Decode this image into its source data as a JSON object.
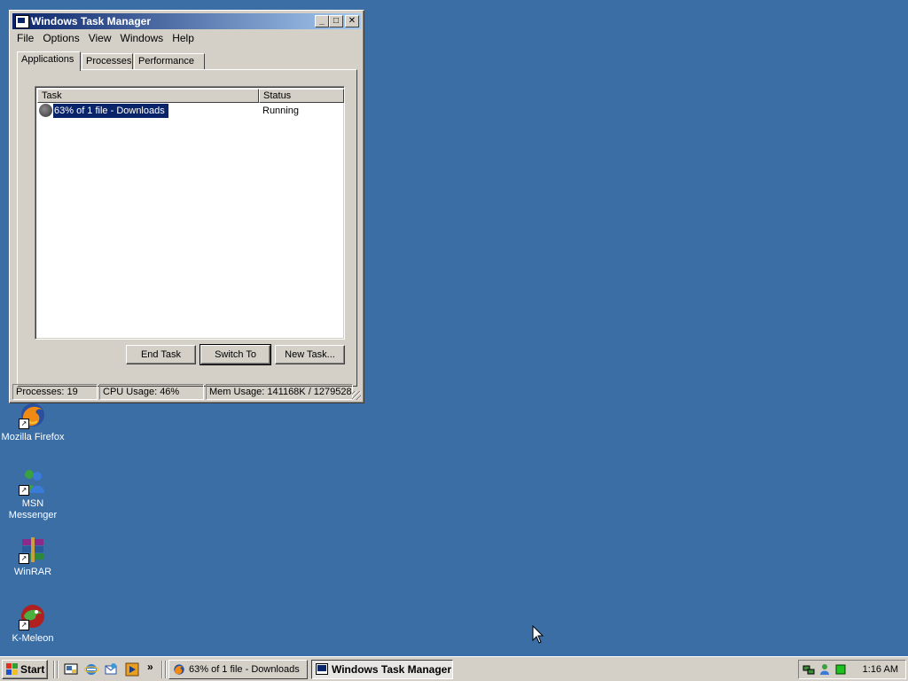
{
  "desktop": {
    "icons": [
      {
        "label": "Mozilla Firefox"
      },
      {
        "label": "MSN Messenger"
      },
      {
        "label": "WinRAR"
      },
      {
        "label": "K-Meleon"
      }
    ]
  },
  "window": {
    "title": "Windows Task Manager",
    "menu": [
      "File",
      "Options",
      "View",
      "Windows",
      "Help"
    ],
    "tabs": [
      "Applications",
      "Processes",
      "Performance"
    ],
    "active_tab": "Applications",
    "list": {
      "columns": [
        "Task",
        "Status"
      ],
      "rows": [
        {
          "task": "63% of 1 file - Downloads",
          "status": "Running"
        }
      ]
    },
    "buttons": {
      "end_task": "End Task",
      "switch_to": "Switch To",
      "new_task": "New Task..."
    },
    "statusbar": {
      "processes": "Processes: 19",
      "cpu": "CPU Usage: 46%",
      "mem": "Mem Usage: 141168K / 1279528"
    }
  },
  "taskbar": {
    "start_label": "Start",
    "overflow": "»",
    "buttons": [
      {
        "label": "63% of 1 file - Downloads",
        "pressed": false
      },
      {
        "label": "Windows Task Manager",
        "pressed": true
      }
    ],
    "clock": "1:16 AM"
  },
  "colors": {
    "desktop": "#3a6ea5",
    "face": "#d4d0c8",
    "title_active": "#0a246a",
    "selection": "#0a246a"
  }
}
